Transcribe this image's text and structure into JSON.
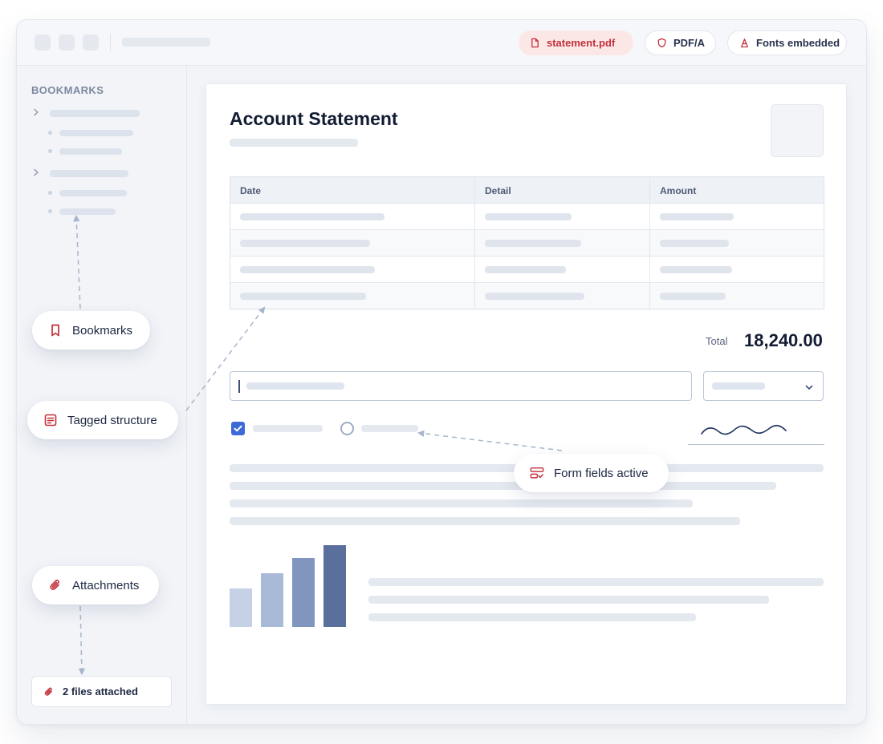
{
  "titlebar": {
    "file_chip": {
      "label": "statement.pdf",
      "icon": "file-icon"
    },
    "pdfa_chip": {
      "label": "PDF/A",
      "icon": "shield-icon"
    },
    "fonts_chip": {
      "label": "Fonts embedded",
      "icon": "font-icon"
    }
  },
  "sidebar": {
    "title": "BOOKMARKS",
    "attachments_box": {
      "label": "2 files attached",
      "icon": "paperclip-icon"
    }
  },
  "callouts": {
    "bookmarks": {
      "label": "Bookmarks",
      "icon": "bookmark-icon"
    },
    "tagged": {
      "label": "Tagged structure",
      "icon": "document-lines-icon"
    },
    "attachments": {
      "label": "Attachments",
      "icon": "paperclip-icon"
    },
    "form_fields": {
      "label": "Form fields active",
      "icon": "form-fields-icon"
    }
  },
  "document": {
    "title": "Account Statement",
    "table": {
      "headers": [
        "Date",
        "Detail",
        "Amount"
      ]
    },
    "total_label": "Total",
    "total_value": "18,240.00",
    "checkbox_checked": true,
    "bar_chart_relative_values": [
      0.47,
      0.66,
      0.84,
      1.0
    ]
  },
  "colors": {
    "accent_red": "#c3303a",
    "chip_red_bg": "#fbe8e6",
    "accent_blue": "#3d6ad8",
    "bar_colors": [
      "#c6d1e6",
      "#a9bad8",
      "#8096bf",
      "#5a6f9c"
    ]
  }
}
